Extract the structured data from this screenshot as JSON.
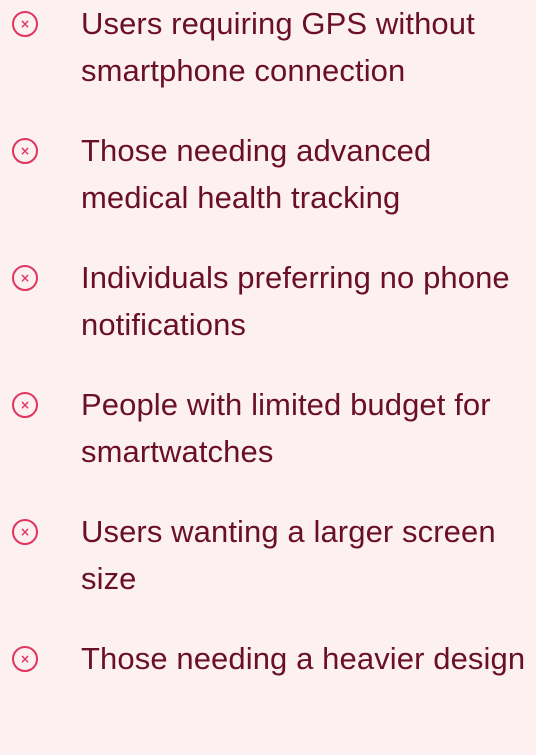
{
  "colors": {
    "background": "#fdf0f1",
    "icon": "#e0355f",
    "text": "#6a1024"
  },
  "items": [
    {
      "icon": "x-circle-icon",
      "text": "Users requiring GPS without smartphone connection"
    },
    {
      "icon": "x-circle-icon",
      "text": "Those needing advanced medical health tracking"
    },
    {
      "icon": "x-circle-icon",
      "text": "Individuals preferring no phone notifications"
    },
    {
      "icon": "x-circle-icon",
      "text": "People with limited budget for smartwatches"
    },
    {
      "icon": "x-circle-icon",
      "text": "Users wanting a larger screen size"
    },
    {
      "icon": "x-circle-icon",
      "text": "Those needing a heavier design"
    }
  ]
}
